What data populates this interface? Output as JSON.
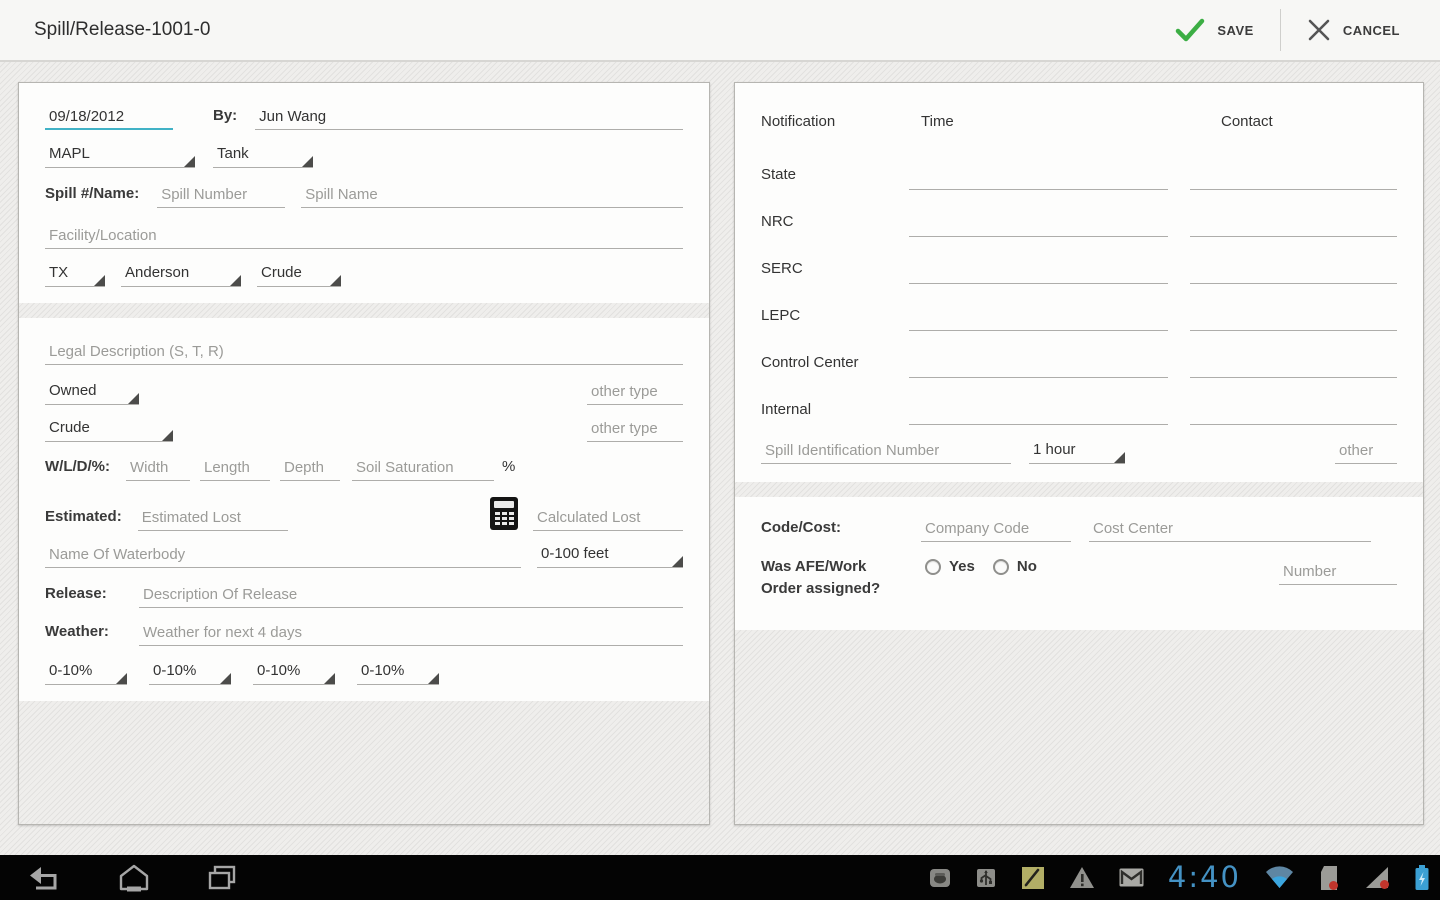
{
  "app_bar": {
    "title": "Spill/Release-1001-0",
    "save_label": "SAVE",
    "cancel_label": "CANCEL"
  },
  "left": {
    "date_value": "09/18/2012",
    "by_label": "By:",
    "by_value": "Jun Wang",
    "org_spinner": "MAPL",
    "source_spinner": "Tank",
    "spill_label": "Spill #/Name:",
    "spill_number_ph": "Spill Number",
    "spill_name_ph": "Spill Name",
    "facility_ph": "Facility/Location",
    "state_spinner": "TX",
    "county_spinner": "Anderson",
    "product_spinner": "Crude",
    "legal_ph": "Legal Description (S, T, R)",
    "owned_spinner": "Owned",
    "owned_other_ph": "other type",
    "crude_spinner": "Crude",
    "crude_other_ph": "other type",
    "wld_label": "W/L/D/%:",
    "width_ph": "Width",
    "length_ph": "Length",
    "depth_ph": "Depth",
    "soil_ph": "Soil Saturation",
    "percent_label": "%",
    "estimated_label": "Estimated:",
    "estimated_ph": "Estimated Lost",
    "calculated_ph": "Calculated Lost",
    "waterbody_ph": "Name Of Waterbody",
    "distance_spinner": "0-100 feet",
    "release_label": "Release:",
    "release_ph": "Description Of Release",
    "weather_label": "Weather:",
    "weather_ph": "Weather for next 4 days",
    "pct_spinners": [
      "0-10%",
      "0-10%",
      "0-10%",
      "0-10%"
    ]
  },
  "right": {
    "headers": {
      "notification": "Notification",
      "time": "Time",
      "contact": "Contact"
    },
    "rows": [
      "State",
      "NRC",
      "SERC",
      "LEPC",
      "Control Center",
      "Internal"
    ],
    "spill_id_ph": "Spill Identification Number",
    "hour_spinner": "1 hour",
    "other_ph": "other",
    "code_label": "Code/Cost:",
    "company_code_ph": "Company Code",
    "cost_center_ph": "Cost Center",
    "afe_label": "Was AFE/Work Order assigned?",
    "yes_label": "Yes",
    "no_label": "No",
    "number_ph": "Number"
  },
  "system_bar": {
    "clock": "4:40"
  },
  "colors": {
    "accent_teal": "#41b2c6",
    "save_green": "#3cae44",
    "holo_blue": "#4492c4"
  },
  "icons": {
    "save": "green-checkmark",
    "cancel": "x-mark",
    "calculator": "calculator-grid",
    "spinner_arrow": "corner-triangle",
    "nav": [
      "back-arrow",
      "home",
      "recent-apps"
    ],
    "status": [
      "app-notification",
      "usb-connected",
      "note-edit",
      "warning",
      "gmail-envelope",
      "wifi",
      "sd-card-error",
      "signal-roaming",
      "battery-charging"
    ]
  }
}
